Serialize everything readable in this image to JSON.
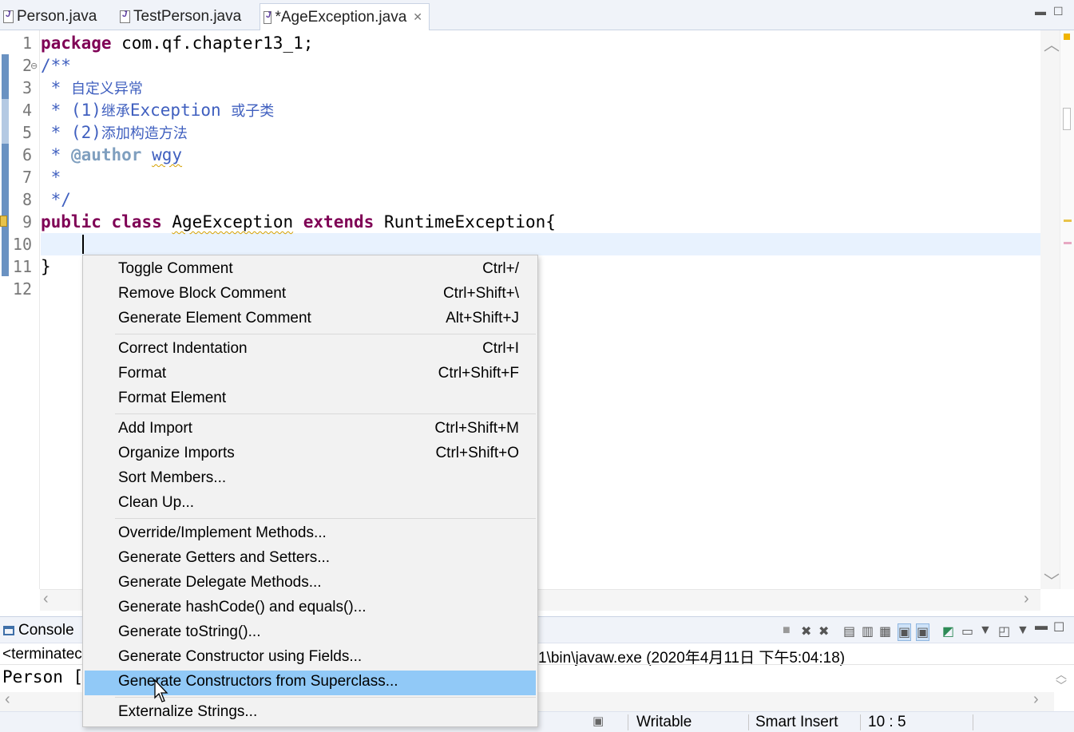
{
  "tabs": [
    {
      "label": "Person.java"
    },
    {
      "label": "TestPerson.java"
    },
    {
      "label": "*AgeException.java",
      "close": "✕"
    }
  ],
  "editor": {
    "line_numbers": [
      "1",
      "2",
      "3",
      "4",
      "5",
      "6",
      "7",
      "8",
      "9",
      "10",
      "11",
      "12"
    ],
    "lines": {
      "l1_kw": "package",
      "l1_rest": " com.qf.chapter13_1;",
      "l2": "/**",
      "l3_star": " * ",
      "l3_text": "自定义异常",
      "l4_a": " * (1)",
      "l4_b": "继承",
      "l4_c": "Exception ",
      "l4_d": "或子类",
      "l5_a": " * (2)",
      "l5_b": "添加构造方法",
      "l6_a": " * ",
      "l6_tag": "@author",
      "l6_sp": " ",
      "l6_name": "wgy",
      "l7": " *",
      "l8": " */",
      "l9_public": "public",
      "l9_class": "class",
      "l9_name": "AgeException",
      "l9_extends": "extends",
      "l9_super": "RuntimeException{",
      "l11": "}"
    }
  },
  "context_menu": {
    "groups": [
      [
        {
          "label": "Toggle Comment",
          "accel": "Ctrl+/"
        },
        {
          "label": "Remove Block Comment",
          "accel": "Ctrl+Shift+\\"
        },
        {
          "label": "Generate Element Comment",
          "accel": "Alt+Shift+J"
        }
      ],
      [
        {
          "label": "Correct Indentation",
          "accel": "Ctrl+I"
        },
        {
          "label": "Format",
          "accel": "Ctrl+Shift+F"
        },
        {
          "label": "Format Element",
          "accel": ""
        }
      ],
      [
        {
          "label": "Add Import",
          "accel": "Ctrl+Shift+M"
        },
        {
          "label": "Organize Imports",
          "accel": "Ctrl+Shift+O"
        },
        {
          "label": "Sort Members...",
          "accel": ""
        },
        {
          "label": "Clean Up...",
          "accel": ""
        }
      ],
      [
        {
          "label": "Override/Implement Methods...",
          "accel": ""
        },
        {
          "label": "Generate Getters and Setters...",
          "accel": ""
        },
        {
          "label": "Generate Delegate Methods...",
          "accel": ""
        },
        {
          "label": "Generate hashCode() and equals()...",
          "accel": ""
        },
        {
          "label": "Generate toString()...",
          "accel": ""
        },
        {
          "label": "Generate Constructor using Fields...",
          "accel": ""
        },
        {
          "label": "Generate Constructors from Superclass...",
          "accel": "",
          "selected": true
        }
      ],
      [
        {
          "label": "Externalize Strings...",
          "accel": ""
        }
      ]
    ],
    "selection_color": "#91c9f7"
  },
  "console": {
    "tab_label": "Console",
    "terminated_prefix": "<terminatec",
    "terminated_suffix": "1\\bin\\javaw.exe (2020年4月11日 下午5:04:18)",
    "output": "Person ["
  },
  "status_bar": {
    "mode": "Writable",
    "insert": "Smart Insert",
    "position": "10 : 5"
  },
  "colors": {
    "keyword": "#7f0055",
    "comment": "#3f5fbf",
    "javadoc_tag": "#7f9fbf",
    "current_line": "#e8f2fe"
  }
}
